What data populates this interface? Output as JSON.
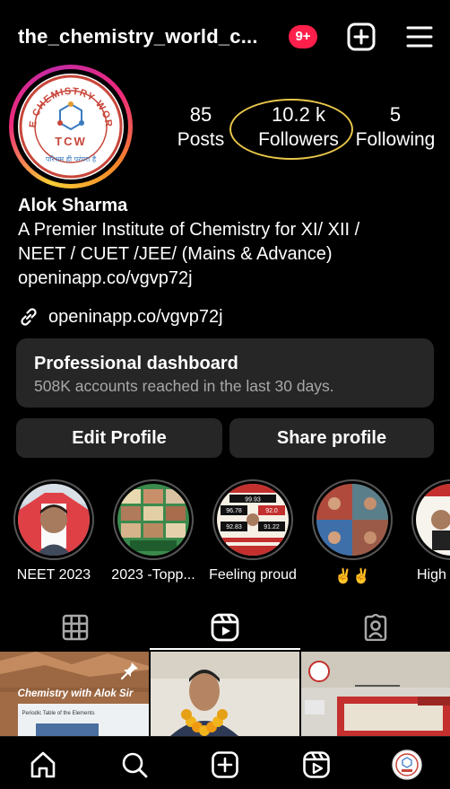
{
  "header": {
    "username": "the_chemistry_world_c...",
    "notification_badge": "9+",
    "add_icon": "plus-square-icon",
    "menu_icon": "hamburger-menu-icon"
  },
  "profile": {
    "logo_top_text": "THE CHEMISTRY WORLD",
    "logo_letters": "TCW",
    "logo_bottom_text": "परिश्रम ही परंपरा है",
    "stats": {
      "posts": {
        "value": "85",
        "label": "Posts"
      },
      "followers": {
        "value": "10.2 k",
        "label": "Followers"
      },
      "following": {
        "value": "5",
        "label": "Following"
      }
    },
    "annotation_color": "#e8c64a",
    "story_ring_colors": [
      "#f9ce34",
      "#ee2a7b",
      "#c32aa3",
      "#f58529"
    ]
  },
  "bio": {
    "name": "Alok Sharma",
    "line1": "A Premier Institute of Chemistry for XI/ XII /",
    "line2": "NEET / CUET /JEE/ (Mains & Advance)",
    "line3": "openinapp.co/vgvp72j",
    "link": "openinapp.co/vgvp72j",
    "link_icon": "link-icon"
  },
  "dashboard": {
    "title": "Professional dashboard",
    "subtitle": "508K accounts reached in the last 30 days."
  },
  "buttons": {
    "edit": "Edit Profile",
    "share": "Share profile"
  },
  "highlights": [
    {
      "label": "NEET 2023"
    },
    {
      "label": "2023 -Topp..."
    },
    {
      "label": "Feeling proud",
      "stat_labels": [
        "99.93",
        "96.78",
        "92.0",
        "92.83",
        "91.22"
      ]
    },
    {
      "label": "✌️✌️"
    },
    {
      "label": "High"
    }
  ],
  "tabs": {
    "grid_icon": "grid-icon",
    "reels_icon": "reels-icon",
    "tagged_icon": "tagged-person-icon",
    "active": "reels"
  },
  "posts_grid": {
    "post1_caption": "Chemistry with Alok Sir",
    "post1_subtext": "Periodic Table of the Elements",
    "post1_pin_icon": "pin-icon"
  },
  "navbar": {
    "home_icon": "home-icon",
    "search_icon": "search-icon",
    "create_icon": "plus-square-icon",
    "reels_icon": "reels-icon",
    "profile_icon": "profile-avatar"
  }
}
